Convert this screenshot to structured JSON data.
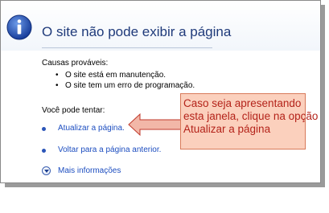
{
  "dialog": {
    "title": "O site não pode exibir a página",
    "causes_label": "Causas prováveis:",
    "causes": [
      "O site está em manutenção.",
      "O site tem um erro de programação."
    ],
    "try_label": "Você pode tentar:",
    "actions": [
      "Atualizar a página.",
      "Voltar para a página anterior."
    ],
    "more_info": "Mais informações"
  },
  "annotation": {
    "lines": [
      "Caso seja apresentando",
      "esta janela, clique na opção",
      "Atualizar a página"
    ]
  },
  "colors": {
    "title": "#1f3a7a",
    "link": "#1d4ec0",
    "callout_fill": "#fbd0bd",
    "callout_text": "#b4231a",
    "arrow_fill": "#f2b7a8"
  },
  "icons": {
    "header": "info-icon",
    "more_info": "expand-down-icon"
  }
}
